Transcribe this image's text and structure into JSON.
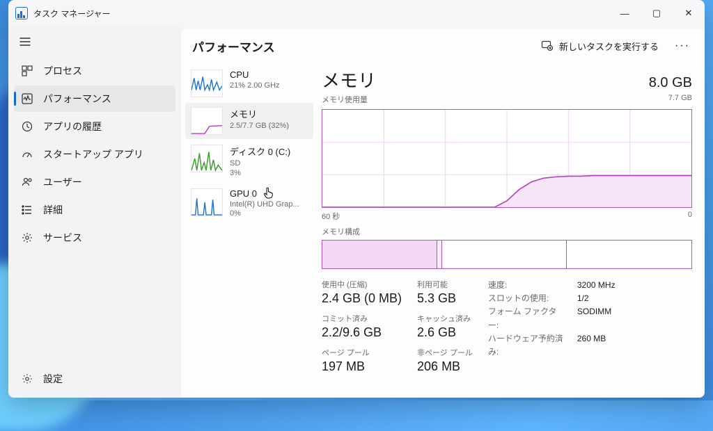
{
  "app": {
    "title": "タスク マネージャー"
  },
  "windowControls": {
    "min": "—",
    "max": "▢",
    "close": "✕"
  },
  "sidebar": {
    "items": [
      {
        "label": "プロセス"
      },
      {
        "label": "パフォーマンス"
      },
      {
        "label": "アプリの履歴"
      },
      {
        "label": "スタートアップ アプリ"
      },
      {
        "label": "ユーザー"
      },
      {
        "label": "詳細"
      },
      {
        "label": "サービス"
      }
    ],
    "settings": "設定"
  },
  "header": {
    "title": "パフォーマンス",
    "runTask": "新しいタスクを実行する"
  },
  "mini": {
    "cpu": {
      "name": "CPU",
      "sub": "21%  2.00 GHz"
    },
    "mem": {
      "name": "メモリ",
      "sub": "2.5/7.7 GB (32%)"
    },
    "disk": {
      "name": "ディスク 0 (C:)",
      "sub1": "SD",
      "sub2": "3%"
    },
    "gpu": {
      "name": "GPU 0",
      "sub1": "Intel(R) UHD Grap...",
      "sub2": "0%"
    }
  },
  "detail": {
    "title": "メモリ",
    "total": "8.0 GB",
    "usageLabel": "メモリ使用量",
    "usableTotal": "7.7 GB",
    "axisLeft": "60 秒",
    "axisRight": "0",
    "compLabel": "メモリ構成",
    "stats": {
      "inUse": {
        "label": "使用中 (圧縮)",
        "value": "2.4 GB (0 MB)"
      },
      "avail": {
        "label": "利用可能",
        "value": "5.3 GB"
      },
      "commit": {
        "label": "コミット済み",
        "value": "2.2/9.6 GB"
      },
      "cached": {
        "label": "キャッシュ済み",
        "value": "2.6 GB"
      },
      "paged": {
        "label": "ページ プール",
        "value": "197 MB"
      },
      "nonpaged": {
        "label": "非ページ プール",
        "value": "206 MB"
      }
    },
    "kv": {
      "speed": {
        "k": "速度:",
        "v": "3200 MHz"
      },
      "slots": {
        "k": "スロットの使用:",
        "v": "1/2"
      },
      "form": {
        "k": "フォーム ファクター:",
        "v": "SODIMM"
      },
      "hw": {
        "k": "ハードウェア予約済み:",
        "v": "260 MB"
      }
    }
  },
  "chart_data": {
    "type": "line",
    "title": "メモリ使用量",
    "xlabel": "秒",
    "ylabel": "GB",
    "xlim": [
      60,
      0
    ],
    "ylim": [
      0,
      7.7
    ],
    "series": [
      {
        "name": "メモリ使用量",
        "x": [
          60,
          55,
          50,
          45,
          40,
          35,
          32,
          30,
          28,
          26,
          24,
          22,
          20,
          18,
          16,
          14,
          12,
          10,
          8,
          6,
          4,
          2,
          0
        ],
        "y": [
          0,
          0,
          0,
          0,
          0,
          0,
          0,
          0.5,
          1.4,
          2.0,
          2.3,
          2.4,
          2.45,
          2.45,
          2.5,
          2.5,
          2.5,
          2.5,
          2.5,
          2.5,
          2.5,
          2.5,
          2.5
        ]
      }
    ],
    "composition": {
      "total_gb": 7.7,
      "in_use_gb": 2.4,
      "modified_gb": 0.1,
      "standby_gb": 2.6,
      "free_gb": 2.6
    }
  }
}
